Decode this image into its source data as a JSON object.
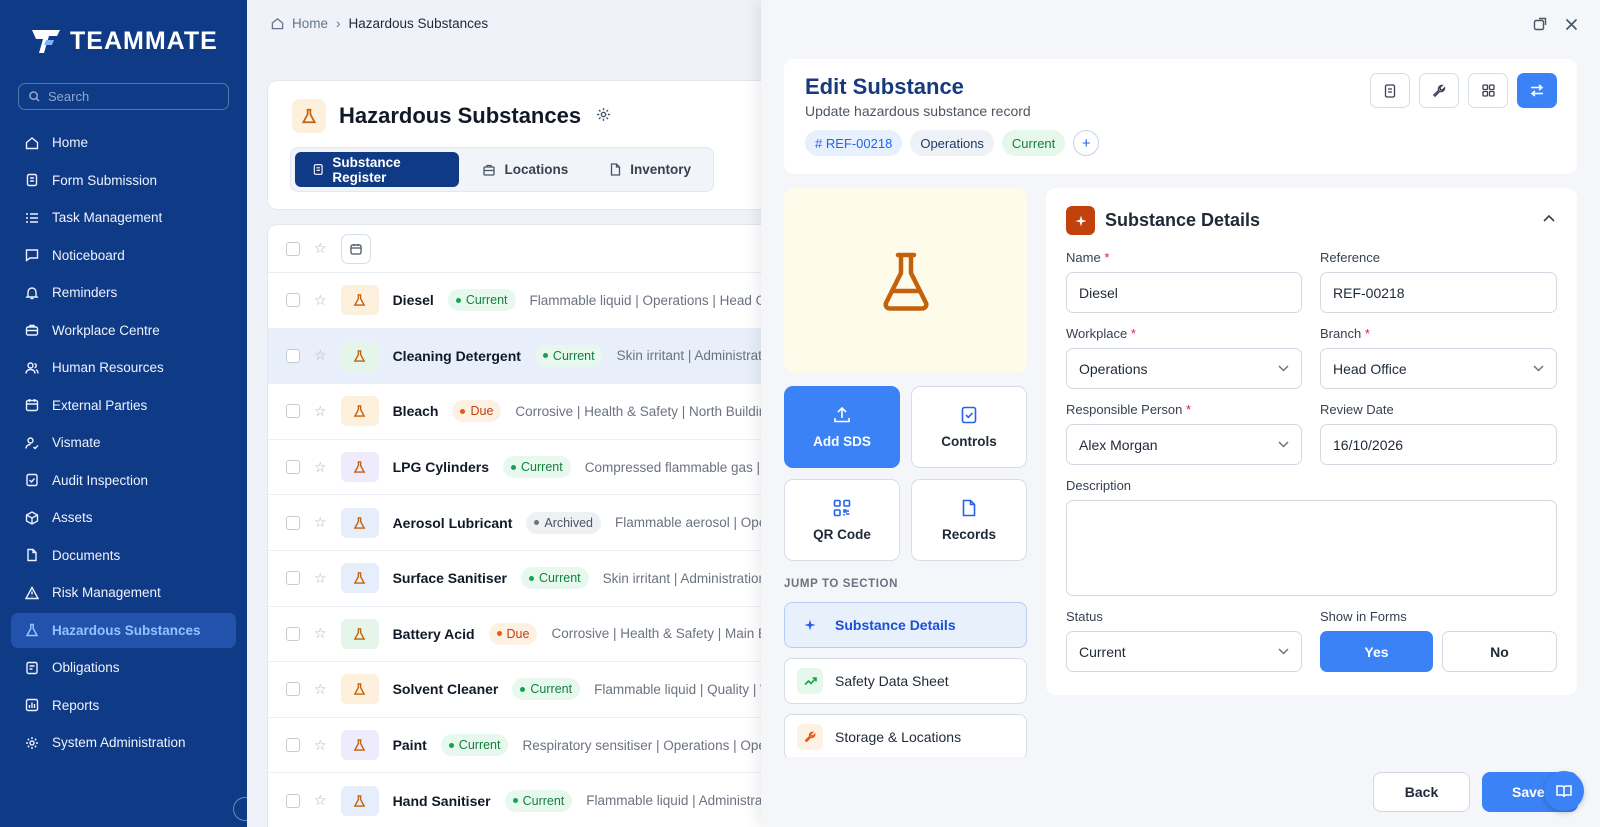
{
  "app": {
    "brand": "TEAMMATE",
    "search_placeholder": "Search"
  },
  "sidebar": {
    "items": [
      {
        "label": "Home",
        "icon": "home-icon"
      },
      {
        "label": "Form Submission",
        "icon": "form-icon"
      },
      {
        "label": "Task Management",
        "icon": "task-list-icon"
      },
      {
        "label": "Noticeboard",
        "icon": "message-icon"
      },
      {
        "label": "Reminders",
        "icon": "bell-icon"
      },
      {
        "label": "Workplace Centre",
        "icon": "briefcase-icon"
      },
      {
        "label": "Human Resources",
        "icon": "users-icon"
      },
      {
        "label": "External Parties",
        "icon": "calendar-icon"
      },
      {
        "label": "Vismate",
        "icon": "user-check-icon"
      },
      {
        "label": "Audit Inspection",
        "icon": "audit-icon"
      },
      {
        "label": "Assets",
        "icon": "box-icon"
      },
      {
        "label": "Documents",
        "icon": "document-icon"
      },
      {
        "label": "Risk Management",
        "icon": "warning-icon"
      },
      {
        "label": "Hazardous Substances",
        "icon": "flask-icon",
        "active": true
      },
      {
        "label": "Obligations",
        "icon": "obligations-icon"
      },
      {
        "label": "Reports",
        "icon": "chart-icon"
      },
      {
        "label": "System Administration",
        "icon": "gear-icon"
      }
    ]
  },
  "breadcrumb": {
    "home": "Home",
    "current": "Hazardous Substances"
  },
  "page": {
    "title": "Hazardous Substances",
    "tabs": [
      {
        "label": "Substance Register",
        "active": true
      },
      {
        "label": "Locations"
      },
      {
        "label": "Inventory"
      }
    ]
  },
  "substances": [
    {
      "name": "Diesel",
      "status": "Current",
      "desc": "Flammable liquid | Operations | Head Office",
      "tone": "orange"
    },
    {
      "name": "Cleaning Detergent",
      "status": "Current",
      "desc": "Skin irritant | Administration",
      "tone": "green",
      "selected": true
    },
    {
      "name": "Bleach",
      "status": "Due",
      "desc": "Corrosive | Health & Safety | North Building",
      "tone": "orange"
    },
    {
      "name": "LPG Cylinders",
      "status": "Current",
      "desc": "Compressed flammable gas | Operations",
      "tone": "purple"
    },
    {
      "name": "Aerosol Lubricant",
      "status": "Archived",
      "desc": "Flammable aerosol | Operations",
      "tone": "blue"
    },
    {
      "name": "Surface Sanitiser",
      "status": "Current",
      "desc": "Skin irritant | Administration",
      "tone": "blue"
    },
    {
      "name": "Battery Acid",
      "status": "Due",
      "desc": "Corrosive | Health & Safety | Main Building",
      "tone": "green"
    },
    {
      "name": "Solvent Cleaner",
      "status": "Current",
      "desc": "Flammable liquid | Quality | Workshop",
      "tone": "orange"
    },
    {
      "name": "Paint",
      "status": "Current",
      "desc": "Respiratory sensitiser | Operations | Operations",
      "tone": "purple"
    },
    {
      "name": "Hand Sanitiser",
      "status": "Current",
      "desc": "Flammable liquid | Administration",
      "tone": "blue"
    }
  ],
  "edit": {
    "title": "Edit Substance",
    "subtitle": "Update hazardous substance record",
    "chips": {
      "ref": "# REF-00218",
      "workplace": "Operations",
      "status": "Current",
      "add": "+"
    },
    "quick_actions": {
      "add_sds": "Add SDS",
      "controls": "Controls",
      "qr": "QR Code",
      "records": "Records"
    },
    "jump_title": "JUMP TO SECTION",
    "jump": [
      {
        "label": "Substance Details",
        "active": true
      },
      {
        "label": "Safety Data Sheet"
      },
      {
        "label": "Storage & Locations"
      }
    ],
    "section_title": "Substance Details",
    "fields": {
      "name_label": "Name",
      "name": "Diesel",
      "ref_label": "Reference",
      "ref": "REF-00218",
      "workplace_label": "Workplace",
      "workplace": "Operations",
      "branch_label": "Branch",
      "branch": "Head Office",
      "person_label": "Responsible Person",
      "person": "Alex Morgan",
      "review_label": "Review Date",
      "review": "16/10/2026",
      "desc_label": "Description",
      "desc": "",
      "status_label": "Status",
      "status": "Current",
      "forms_label": "Show in Forms",
      "yes": "Yes",
      "no": "No",
      "required_mark": "*"
    },
    "footer": {
      "back": "Back",
      "save": "Save"
    }
  }
}
